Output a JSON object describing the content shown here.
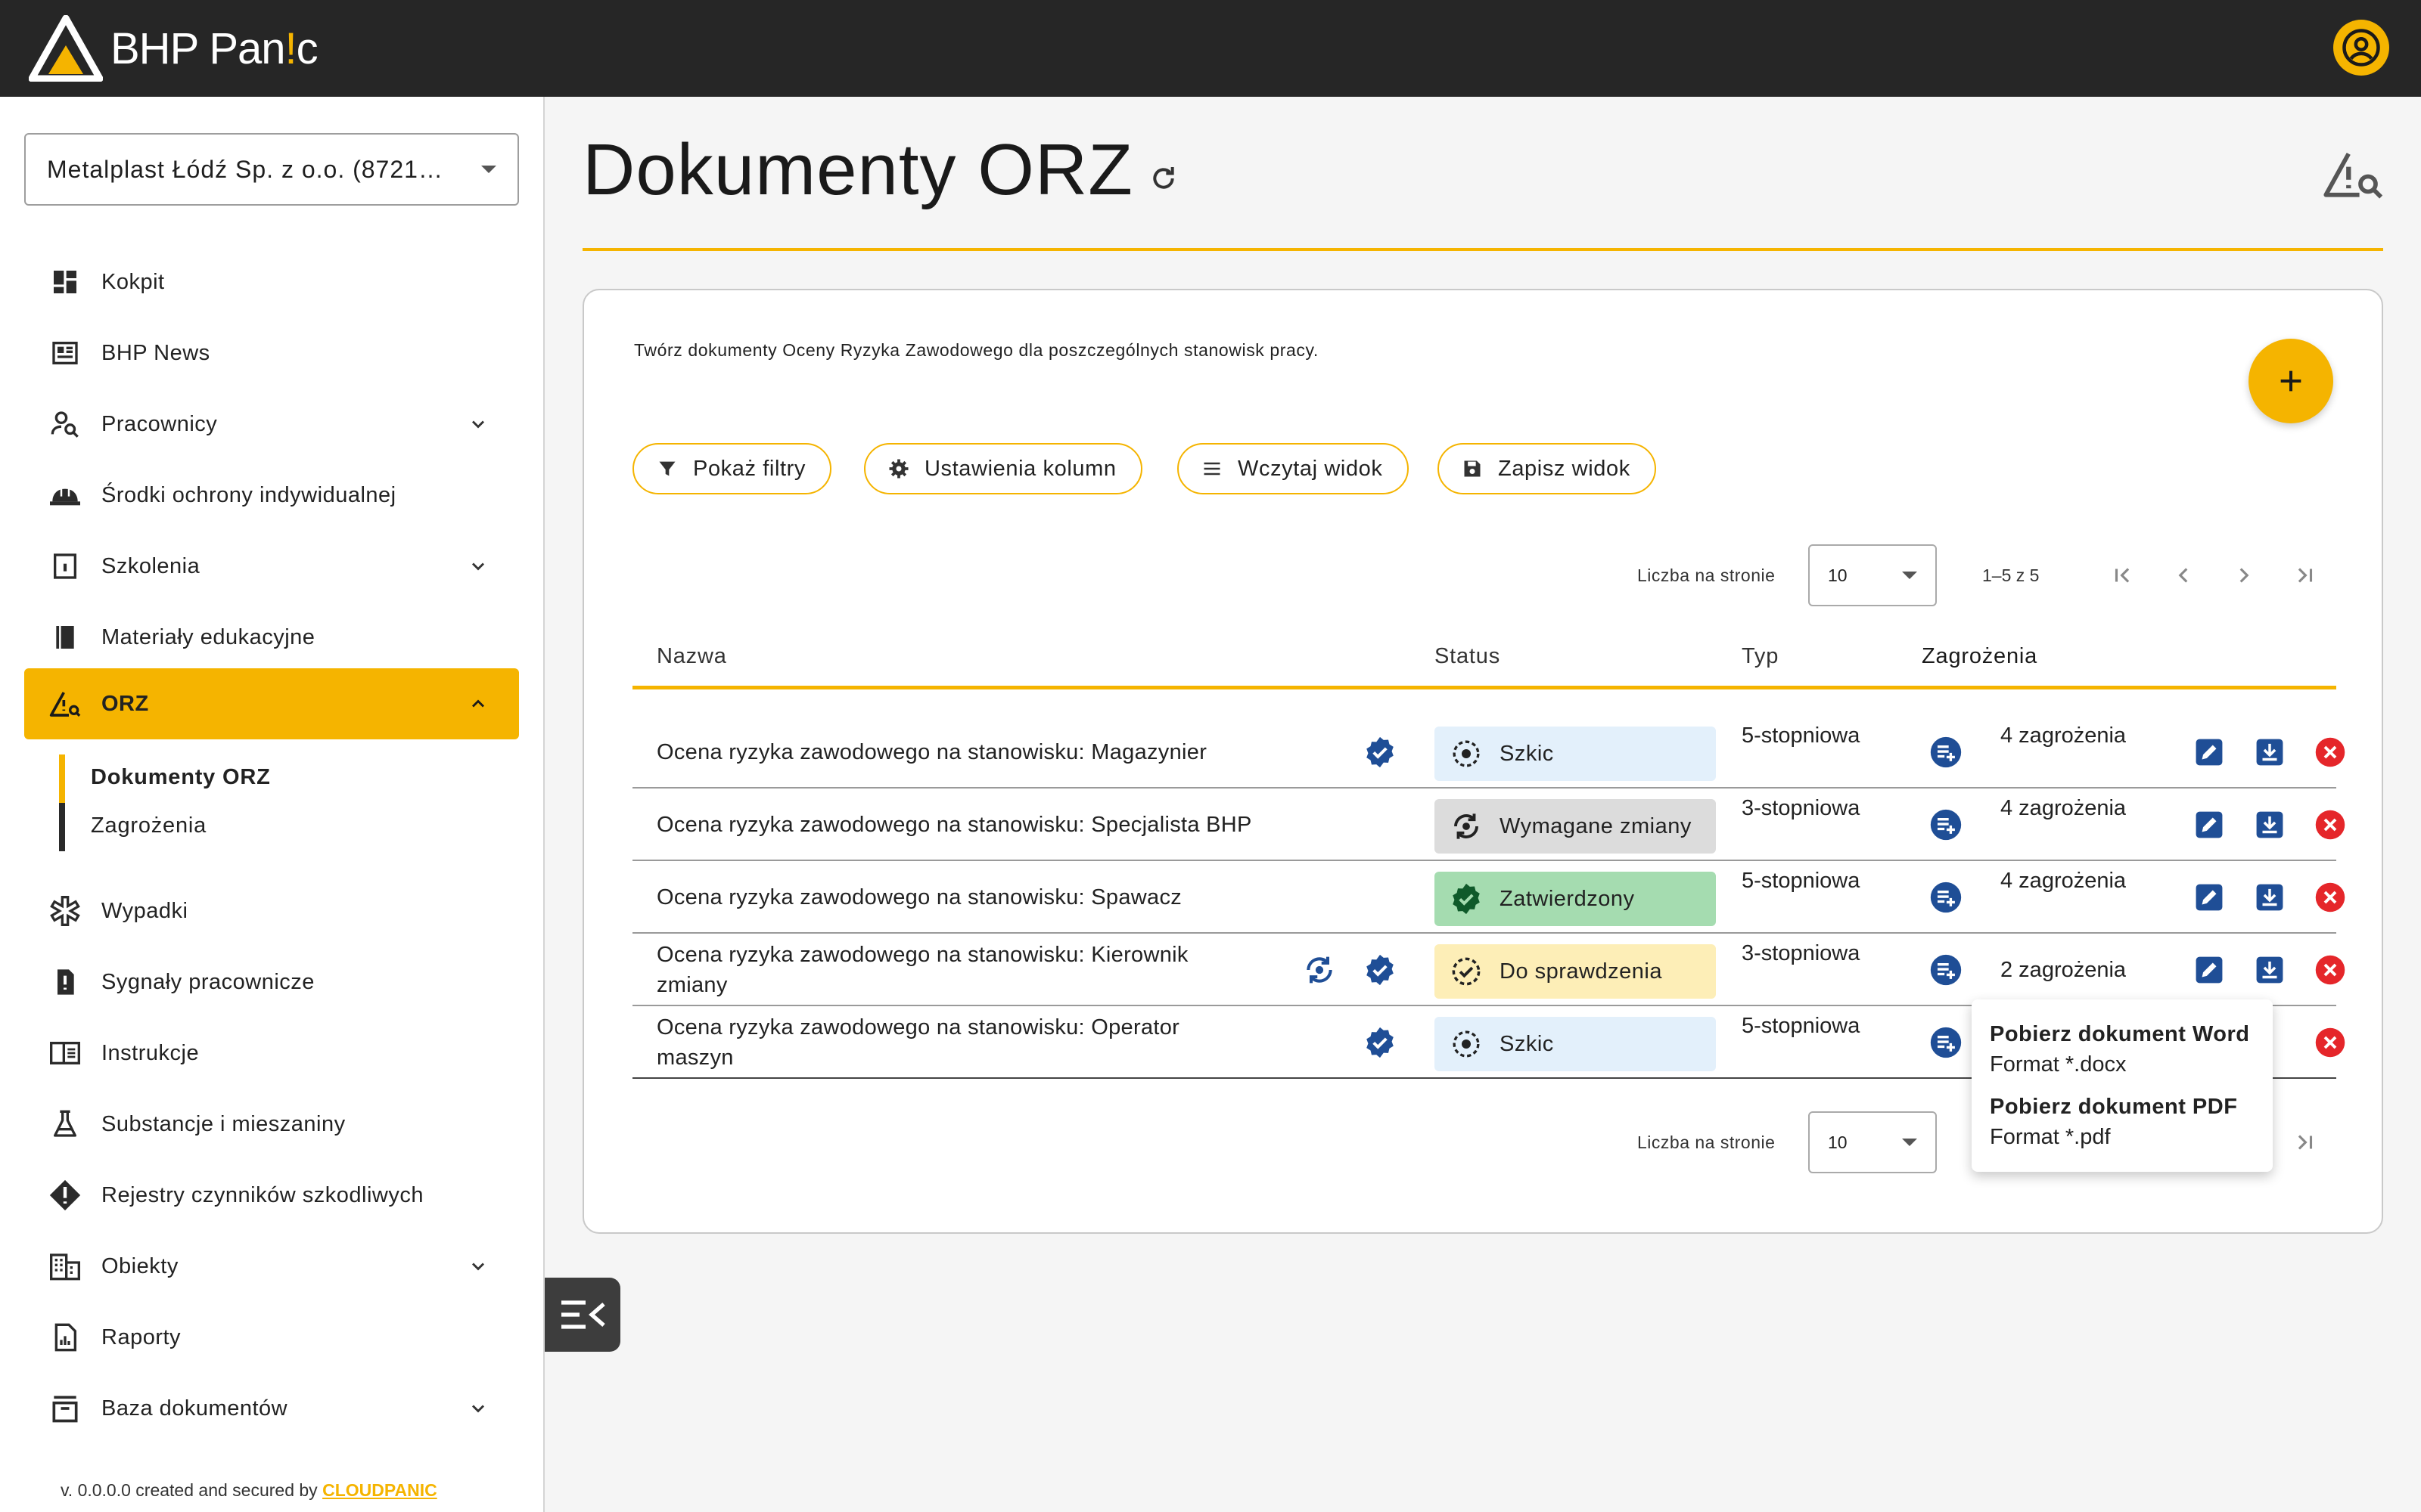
{
  "app": {
    "name": "BHP Pan",
    "name_accent": "!",
    "name_tail": "c"
  },
  "colors": {
    "accent": "#f5b400",
    "topbar": "#262626",
    "primary_icon": "#1f4e96",
    "danger": "#e5262a"
  },
  "company": {
    "selected": "Metalplast Łódź Sp. z o.o. (8721…"
  },
  "sidebar": {
    "items": [
      {
        "label": "Kokpit",
        "icon": "dashboard-icon"
      },
      {
        "label": "BHP News",
        "icon": "news-icon"
      },
      {
        "label": "Pracownicy",
        "icon": "person-search-icon"
      },
      {
        "label": "Środki ochrony indywidualnej",
        "icon": "helmet-icon"
      },
      {
        "label": "Szkolenia",
        "icon": "training-book-icon"
      },
      {
        "label": "Materiały edukacyjne",
        "icon": "book-icon"
      },
      {
        "label": "ORZ",
        "icon": "warning-search-icon"
      },
      {
        "label": "Wypadki",
        "icon": "medical-icon"
      },
      {
        "label": "Sygnały pracownicze",
        "icon": "report-icon"
      },
      {
        "label": "Instrukcje",
        "icon": "instructions-icon"
      },
      {
        "label": "Substancje i mieszaniny",
        "icon": "flask-icon"
      },
      {
        "label": "Rejestry czynników szkodliwych",
        "icon": "hazard-diamond-icon"
      },
      {
        "label": "Obiekty",
        "icon": "building-icon"
      },
      {
        "label": "Raporty",
        "icon": "report-chart-icon"
      },
      {
        "label": "Baza dokumentów",
        "icon": "archive-icon"
      }
    ],
    "sub_items": [
      {
        "label": "Dokumenty ORZ"
      },
      {
        "label": "Zagrożenia"
      }
    ],
    "version": "v. 0.0.0.0 created and secured by",
    "vendor": "CLOUDPANIC"
  },
  "page": {
    "title": "Dokumenty ORZ",
    "description": "Twórz dokumenty Oceny Ryzyka Zawodowego dla poszczególnych stanowisk pracy.",
    "toolbar": {
      "filters": "Pokaż filtry",
      "columns": "Ustawienia kolumn",
      "load_view": "Wczytaj widok",
      "save_view": "Zapisz widok"
    },
    "pager": {
      "label": "Liczba na stronie",
      "per_page": "10",
      "range": "1–5 z 5"
    },
    "columns": {
      "name": "Nazwa",
      "status": "Status",
      "type": "Typ",
      "hazards": "Zagrożenia"
    },
    "rows": [
      {
        "name": "Ocena ryzyka zawodowego na stanowisku: Magazynier",
        "status": "Szkic",
        "type": "5-stopniowa",
        "hazards": "4 zagrożenia"
      },
      {
        "name": "Ocena ryzyka zawodowego na stanowisku: Specjalista BHP",
        "status": "Wymagane zmiany",
        "type": "3-stopniowa",
        "hazards": "4 zagrożenia"
      },
      {
        "name": "Ocena ryzyka zawodowego na stanowisku: Spawacz",
        "status": "Zatwierdzony",
        "type": "5-stopniowa",
        "hazards": "4 zagrożenia"
      },
      {
        "name": "Ocena ryzyka zawodowego na stanowisku: Kierownik zmiany",
        "status": "Do sprawdzenia",
        "type": "3-stopniowa",
        "hazards": "2 zagrożenia"
      },
      {
        "name": "Ocena ryzyka zawodowego na stanowisku: Operator maszyn",
        "status": "Szkic",
        "type": "5-stopniowa",
        "hazards": ""
      }
    ],
    "download_menu": {
      "word_title": "Pobierz dokument Word",
      "word_format": "Format *.docx",
      "pdf_title": "Pobierz dokument PDF",
      "pdf_format": "Format *.pdf"
    }
  }
}
